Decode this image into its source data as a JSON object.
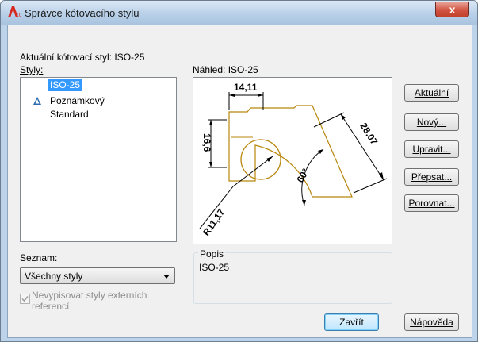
{
  "window": {
    "title": "Správce kótovacího stylu",
    "close_glyph": "x",
    "icon": "autocad-app-icon"
  },
  "current_style": {
    "label": "Aktuální kótovací styl: ISO-25"
  },
  "styles": {
    "label": "Styly:",
    "items": [
      {
        "label": "ISO-25",
        "selected": true,
        "annotative": false
      },
      {
        "label": "Poznámkový",
        "selected": false,
        "annotative": true
      },
      {
        "label": "Standard",
        "selected": false,
        "annotative": false
      }
    ]
  },
  "preview": {
    "label": "Náhled: ISO-25",
    "dims": {
      "top": "14,11",
      "left": "16,6",
      "diagonal": "28,07",
      "angle": "60°",
      "radius": "R11,17"
    }
  },
  "list_filter": {
    "label": "Seznam:",
    "selected": "Všechny styly"
  },
  "xref_checkbox": {
    "line1": "Nevypisovat styly externích",
    "line2": "referencí",
    "checked": true,
    "disabled": true
  },
  "description": {
    "label": "Popis",
    "value": "ISO-25"
  },
  "buttons": {
    "set_current": "Aktuální",
    "new": "Nový...",
    "modify": "Upravit...",
    "override": "Přepsat...",
    "compare": "Porovnat...",
    "close": "Zavřít",
    "help": "Nápověda"
  },
  "colors": {
    "preview_geometry": "#b8860b",
    "preview_dimensions": "#000000",
    "selection": "#3399ff"
  }
}
